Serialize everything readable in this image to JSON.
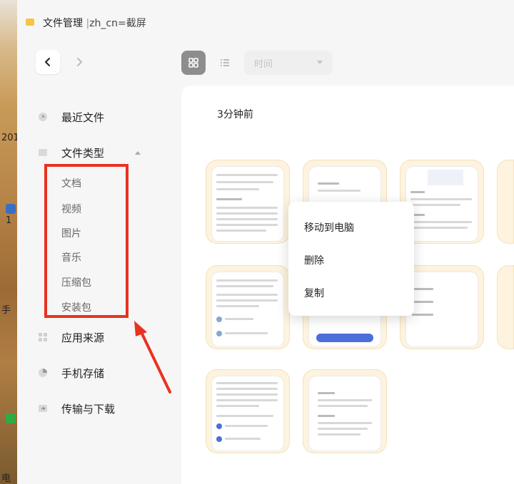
{
  "window": {
    "title": "文件管理",
    "separator": "|",
    "subtitle": "zh_cn=截屏"
  },
  "toolbar": {
    "sort_value": "时间"
  },
  "sidebar": {
    "items": [
      {
        "label": "最近文件",
        "icon": "clock-icon"
      },
      {
        "label": "文件类型",
        "icon": "folder-icon"
      },
      {
        "label": "应用来源",
        "icon": "apps-icon"
      },
      {
        "label": "手机存储",
        "icon": "pie-chart-icon"
      },
      {
        "label": "传输与下载",
        "icon": "download-icon"
      }
    ],
    "file_types": [
      "文档",
      "视频",
      "图片",
      "音乐",
      "压缩包",
      "安装包"
    ]
  },
  "content": {
    "group_title": "3分钟前"
  },
  "context_menu": {
    "items": [
      "移动到电脑",
      "删除",
      "复制"
    ]
  },
  "desktop": {
    "labels": [
      "201",
      "1",
      "手",
      "电"
    ]
  },
  "colors": {
    "highlight_box": "#e8321f",
    "thumb_bg": "#fdf3de",
    "folder_icon": "#f5c542"
  }
}
